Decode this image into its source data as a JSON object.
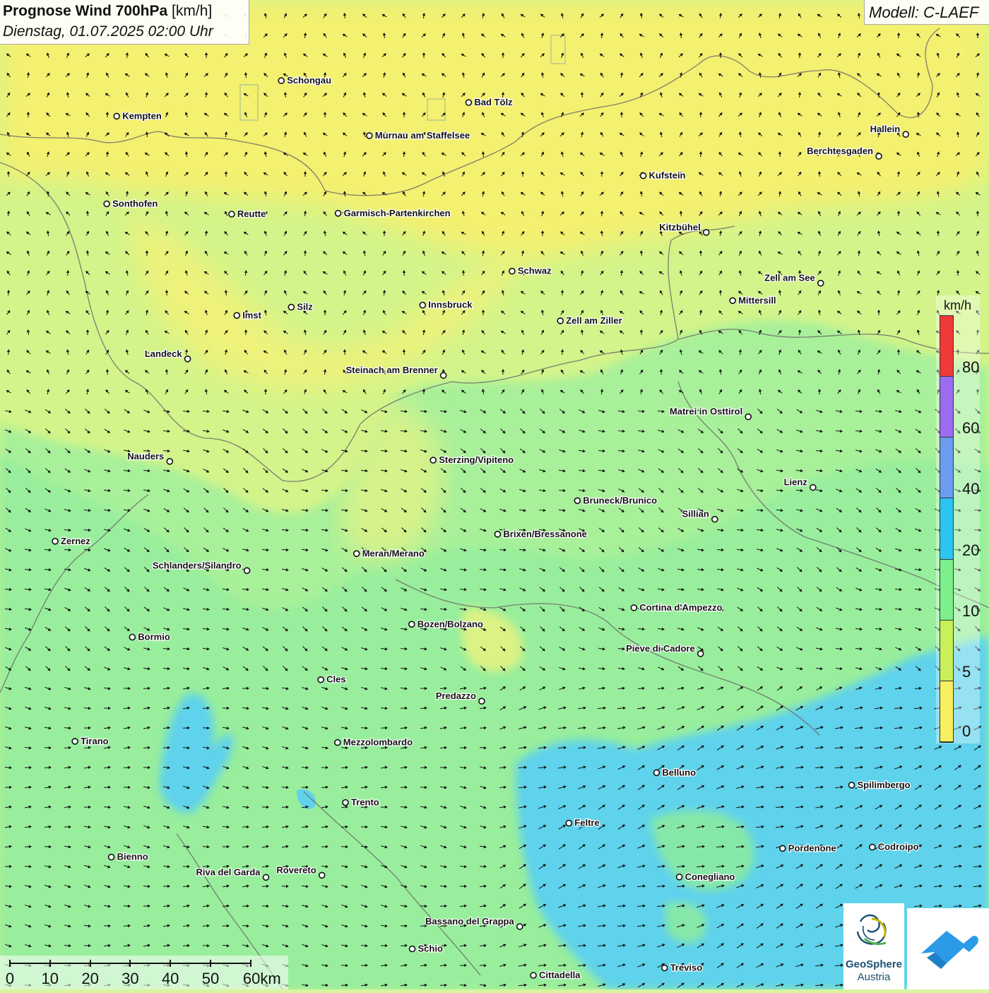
{
  "header": {
    "title_bold": "Prognose Wind 700hPa",
    "title_unit": "[km/h]",
    "datetime": "Dienstag, 01.07.2025 02:00 Uhr"
  },
  "model": "Modell: C-LAEF",
  "legend": {
    "unit": "km/h",
    "labels": [
      "80",
      "60",
      "40",
      "20",
      "10",
      "5",
      "0"
    ],
    "colors": [
      "#f03a3a",
      "#9c6cf0",
      "#6c9cf0",
      "#2cc4f0",
      "#7cf08c",
      "#c8f05a",
      "#f8f060"
    ]
  },
  "scale": {
    "labels": [
      "0",
      "10",
      "20",
      "30",
      "40",
      "50",
      "60km"
    ]
  },
  "logo": {
    "name": "GeoSphere",
    "sub": "Austria"
  },
  "cities": [
    {
      "name": "Schongau",
      "lon": 10.895,
      "lat": 47.813
    },
    {
      "name": "Bad Tölz",
      "lon": 11.555,
      "lat": 47.76
    },
    {
      "name": "Kempten",
      "lon": 10.315,
      "lat": 47.727
    },
    {
      "name": "Murnau am Staffelsee",
      "lon": 11.205,
      "lat": 47.68
    },
    {
      "name": "Hallein",
      "lon": 13.095,
      "lat": 47.683
    },
    {
      "name": "Berchtesgaden",
      "lon": 13.0,
      "lat": 47.63
    },
    {
      "name": "Kufstein",
      "lon": 12.17,
      "lat": 47.583
    },
    {
      "name": "Sonthofen",
      "lon": 10.28,
      "lat": 47.515
    },
    {
      "name": "Reutte",
      "lon": 10.72,
      "lat": 47.49
    },
    {
      "name": "Garmisch-Partenkirchen",
      "lon": 11.095,
      "lat": 47.492
    },
    {
      "name": "Kitzbühel",
      "lon": 12.392,
      "lat": 47.446
    },
    {
      "name": "Schwaz",
      "lon": 11.708,
      "lat": 47.352
    },
    {
      "name": "Zell am See",
      "lon": 12.795,
      "lat": 47.323
    },
    {
      "name": "Mittersill",
      "lon": 12.485,
      "lat": 47.281
    },
    {
      "name": "Silz",
      "lon": 10.93,
      "lat": 47.265
    },
    {
      "name": "Innsbruck",
      "lon": 11.393,
      "lat": 47.27
    },
    {
      "name": "Imst",
      "lon": 10.738,
      "lat": 47.245
    },
    {
      "name": "Zell am Ziller",
      "lon": 11.878,
      "lat": 47.232
    },
    {
      "name": "Landeck",
      "lon": 10.565,
      "lat": 47.14
    },
    {
      "name": "Steinach am Brenner",
      "lon": 11.466,
      "lat": 47.1
    },
    {
      "name": "Matrei in Osttirol",
      "lon": 12.54,
      "lat": 47.0
    },
    {
      "name": "Nauders",
      "lon": 10.502,
      "lat": 46.892
    },
    {
      "name": "Sterzing/Vipiteno",
      "lon": 11.43,
      "lat": 46.895
    },
    {
      "name": "Lienz",
      "lon": 12.768,
      "lat": 46.829
    },
    {
      "name": "Bruneck/Brunico",
      "lon": 11.938,
      "lat": 46.797
    },
    {
      "name": "Sillian",
      "lon": 12.422,
      "lat": 46.752
    },
    {
      "name": "Brixen/Bressanone",
      "lon": 11.657,
      "lat": 46.716
    },
    {
      "name": "Zernez",
      "lon": 10.098,
      "lat": 46.699
    },
    {
      "name": "Meran/Merano",
      "lon": 11.16,
      "lat": 46.669
    },
    {
      "name": "Schlanders/Silandro",
      "lon": 10.774,
      "lat": 46.628
    },
    {
      "name": "Cortina d'Ampezzo",
      "lon": 12.137,
      "lat": 46.538
    },
    {
      "name": "Bozen/Bolzano",
      "lon": 11.354,
      "lat": 46.498
    },
    {
      "name": "Bormio",
      "lon": 10.37,
      "lat": 46.467
    },
    {
      "name": "Pieve di Cadore",
      "lon": 12.372,
      "lat": 46.427
    },
    {
      "name": "Cles",
      "lon": 11.034,
      "lat": 46.364
    },
    {
      "name": "Predazzo",
      "lon": 11.601,
      "lat": 46.312
    },
    {
      "name": "Tirano",
      "lon": 10.168,
      "lat": 46.215
    },
    {
      "name": "Mezzolombardo",
      "lon": 11.093,
      "lat": 46.212
    },
    {
      "name": "Belluno",
      "lon": 12.217,
      "lat": 46.139
    },
    {
      "name": "Spilimbergo",
      "lon": 12.904,
      "lat": 46.109
    },
    {
      "name": "Feltre",
      "lon": 11.908,
      "lat": 46.017
    },
    {
      "name": "Trento",
      "lon": 11.121,
      "lat": 46.067
    },
    {
      "name": "Pordenone",
      "lon": 12.661,
      "lat": 45.956
    },
    {
      "name": "Codroipo",
      "lon": 12.977,
      "lat": 45.959
    },
    {
      "name": "Bienno",
      "lon": 10.296,
      "lat": 45.935
    },
    {
      "name": "Riva del Garda",
      "lon": 10.841,
      "lat": 45.886
    },
    {
      "name": "Rovereto",
      "lon": 11.038,
      "lat": 45.891
    },
    {
      "name": "Conegliano",
      "lon": 12.297,
      "lat": 45.887
    },
    {
      "name": "Bassano del Grappa",
      "lon": 11.735,
      "lat": 45.767
    },
    {
      "name": "Schio",
      "lon": 11.356,
      "lat": 45.713
    },
    {
      "name": "Treviso",
      "lon": 12.245,
      "lat": 45.667
    },
    {
      "name": "Cittadella",
      "lon": 11.783,
      "lat": 45.649
    }
  ]
}
